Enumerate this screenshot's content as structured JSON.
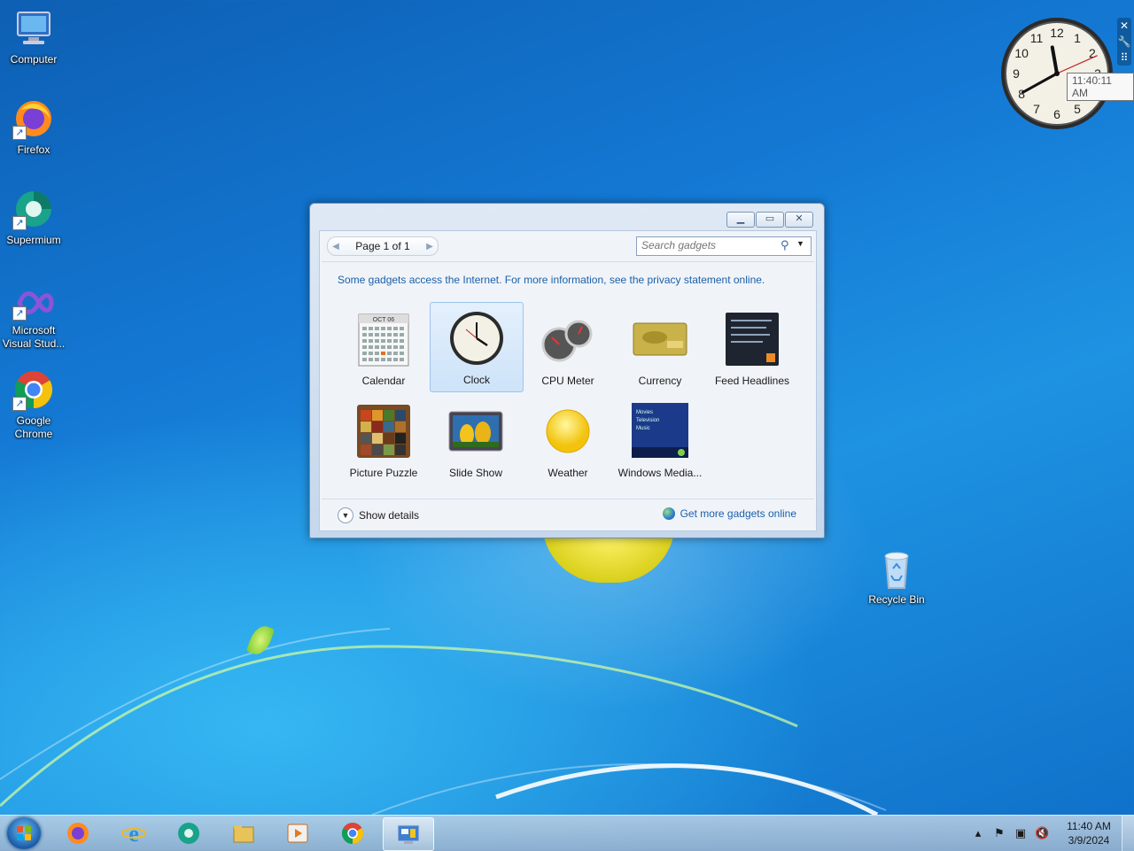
{
  "desktop": {
    "icons": [
      {
        "label": "Computer",
        "icon": "computer-icon"
      },
      {
        "label": "Firefox",
        "icon": "firefox-icon"
      },
      {
        "label": "Supermium",
        "icon": "supermium-icon"
      },
      {
        "label": "Microsoft Visual Stud...",
        "icon": "visual-studio-icon"
      },
      {
        "label": "Google Chrome",
        "icon": "chrome-icon"
      },
      {
        "label": "Recycle Bin",
        "icon": "recycle-bin-icon"
      }
    ]
  },
  "clock_gadget": {
    "tooltip": "11:40:11 AM",
    "time": {
      "hour": 11,
      "minute": 40,
      "second": 11
    },
    "controls": [
      "close-icon",
      "options-icon",
      "drag-handle-icon"
    ]
  },
  "gadgets_window": {
    "pager": {
      "prev_icon": "prev-arrow-icon",
      "label": "Page 1 of 1",
      "next_icon": "next-arrow-icon"
    },
    "search": {
      "placeholder": "Search gadgets",
      "value": ""
    },
    "note": "Some gadgets access the Internet.  For more information, see the privacy statement online.",
    "gadgets": [
      {
        "label": "Calendar",
        "selected": false,
        "icon": "calendar-icon"
      },
      {
        "label": "Clock",
        "selected": true,
        "icon": "clock-icon"
      },
      {
        "label": "CPU Meter",
        "selected": false,
        "icon": "cpu-meter-icon"
      },
      {
        "label": "Currency",
        "selected": false,
        "icon": "currency-icon"
      },
      {
        "label": "Feed Headlines",
        "selected": false,
        "icon": "feed-headlines-icon"
      },
      {
        "label": "Picture Puzzle",
        "selected": false,
        "icon": "picture-puzzle-icon"
      },
      {
        "label": "Slide Show",
        "selected": false,
        "icon": "slide-show-icon"
      },
      {
        "label": "Weather",
        "selected": false,
        "icon": "weather-icon"
      },
      {
        "label": "Windows Media...",
        "selected": false,
        "icon": "windows-media-icon"
      }
    ],
    "calendar_thumb": {
      "month": "OCT 06"
    },
    "media_thumb": {
      "lines": [
        "Movies",
        "Television",
        "Music"
      ]
    },
    "show_details": "Show details",
    "get_more": "Get more gadgets online"
  },
  "taskbar": {
    "apps": [
      "firefox-icon",
      "internet-explorer-icon",
      "supermium-icon",
      "file-explorer-icon",
      "media-player-icon",
      "chrome-icon",
      "gadgets-icon"
    ],
    "active_app": "gadgets-icon",
    "tray_icons": [
      "show-hidden-icons-icon",
      "action-center-flag-icon",
      "network-icon",
      "volume-muted-icon"
    ],
    "time": "11:40 AM",
    "date": "3/9/2024"
  }
}
